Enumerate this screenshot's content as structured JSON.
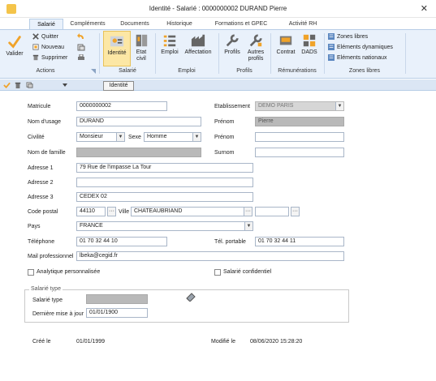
{
  "window": {
    "title": "Identité - Salarié : 0000000002 DURAND Pierre",
    "close_glyph": "✕"
  },
  "tabs": [
    {
      "label": "Salarié"
    },
    {
      "label": "Compléments"
    },
    {
      "label": "Documents"
    },
    {
      "label": "Historique"
    },
    {
      "label": "Formations et GPEC"
    },
    {
      "label": "Activité RH"
    }
  ],
  "ribbon": {
    "valider": "Valider",
    "quitter": "Quitter",
    "nouveau": "Nouveau",
    "supprimer": "Supprimer",
    "identite": "Identité",
    "etat_civil": "Etat civil",
    "emploi": "Emploi",
    "affectation": "Affectation",
    "profils": "Profils",
    "autres_profils": "Autres profils",
    "contrat": "Contrat",
    "dads": "DADS",
    "zones_libres": "Zones libres",
    "elements_dynamiques": "Eléments dynamiques",
    "elements_nationaux": "Eléments nationaux",
    "groups": {
      "actions": "Actions",
      "salarie": "Salarié",
      "emploi": "Emploi",
      "profils": "Profils",
      "remunerations": "Rémunérations",
      "zones_libres": "Zones libres"
    }
  },
  "tooltip": "Identité",
  "form": {
    "matricule_label": "Matricule",
    "matricule": "0000000002",
    "etablissement_label": "Etablissement",
    "etablissement": "DEMO PARIS",
    "nom_usage_label": "Nom d'usage",
    "nom_usage": "DURAND",
    "prenom_label": "Prénom",
    "prenom": "Pierre",
    "civilite_label": "Civilité",
    "civilite": "Monsieur",
    "sexe_label": "Sexe",
    "sexe": "Homme",
    "prenom2_label": "Prénom",
    "prenom2": "",
    "nom_famille_label": "Nom de famille",
    "nom_famille": "",
    "surnom_label": "Surnom",
    "surnom": "",
    "adresse1_label": "Adresse 1",
    "adresse1": "79  Rue de l'impasse La Tour",
    "adresse2_label": "Adresse 2",
    "adresse2": "",
    "adresse3_label": "Adresse 3",
    "adresse3": "CEDEX 02",
    "cp_label": "Code postal",
    "cp": "44110",
    "ville_label": "Ville",
    "ville": "CHATEAUBRIAND",
    "pays_label": "Pays",
    "pays": "FRANCE",
    "telephone_label": "Téléphone",
    "telephone": "01 70 32 44 10",
    "tel_portable_label": "Tél. portable",
    "tel_portable": "01 70 32 44 11",
    "mail_label": "Mail professionnel",
    "mail": "lbeka@cegid.fr",
    "analytique_label": "Analytique personnalisée",
    "confidentiel_label": "Salarié confidentiel",
    "salarie_type_group": "Salarié type",
    "salarie_type_label": "Salarié type",
    "salarie_type": "",
    "derniere_maj_label": "Dernière mise à jour",
    "derniere_maj": "01/01/1900",
    "cree_label": "Créé le",
    "cree": "01/01/1999",
    "modifie_label": "Modifié le",
    "modifie": "08/06/2020 15:28:20"
  },
  "icons": [
    "app-icon",
    "valider-check-icon",
    "quitter-x-icon",
    "nouveau-icon",
    "supprimer-icon",
    "undo-icon",
    "identite-icon",
    "etat-civil-icon",
    "emploi-icon",
    "affectation-icon",
    "profils-icon",
    "contrat-icon",
    "dads-icon",
    "eraser-icon"
  ],
  "colors": {
    "ribbon_bg": "#e9f1fb",
    "accent_orange": "#f0a32a",
    "selected_bg": "#fce7a5",
    "toolbar_bg": "#dbe6f4"
  }
}
